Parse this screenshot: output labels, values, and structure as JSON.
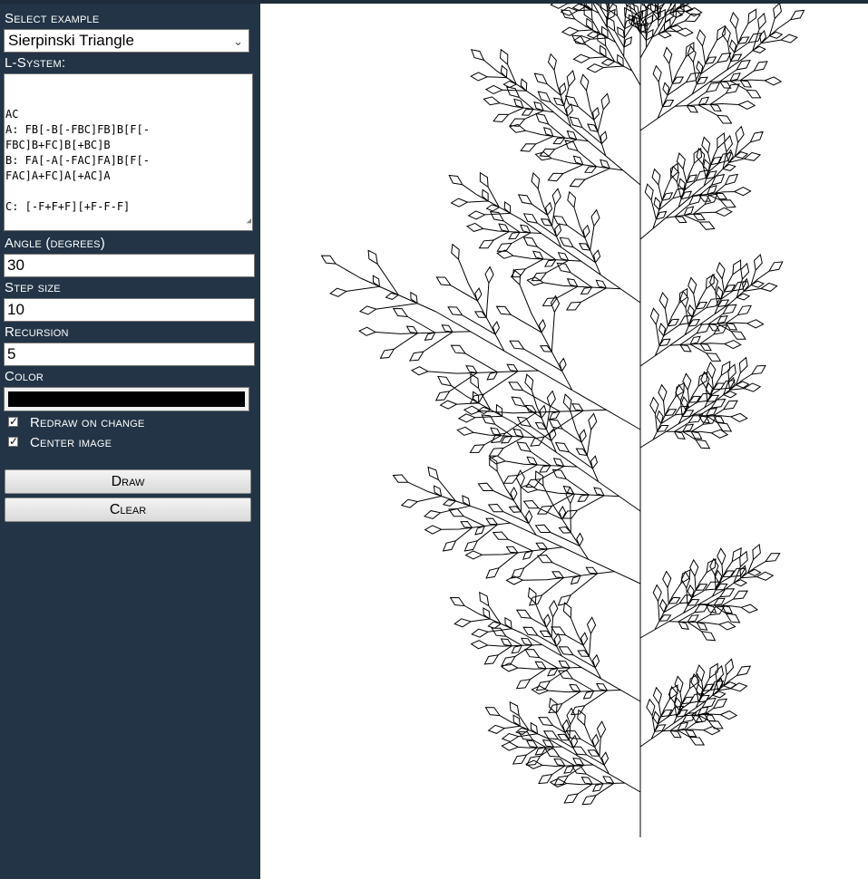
{
  "sidebar": {
    "select_label": "Select example",
    "select_value": "Sierpinski Triangle",
    "lsystem_label": "L-System:",
    "lsystem_lines": [
      "AC",
      "A: FB[-B[-FBC]FB]B[F[-",
      "FBC]B+FC]B[+BC]B",
      "B: FA[-A[-FAC]FA]B[F[-",
      "FAC]A+FC]A[+AC]A",
      "",
      "C: [-F+F+F][+F-F-F]"
    ],
    "angle_label": "Angle (degrees)",
    "angle_value": "30",
    "step_label": "Step size",
    "step_value": "10",
    "recursion_label": "Recursion",
    "recursion_value": "5",
    "color_label": "Color",
    "color_value": "#000000",
    "redraw_label": "Redraw on change",
    "redraw_checked": true,
    "center_label": "Center image",
    "center_checked": true,
    "draw_label": "Draw",
    "clear_label": "Clear"
  },
  "colors": {
    "sidebar_bg": "#223446",
    "canvas_bg": "#ffffff",
    "stroke": "#000000"
  }
}
